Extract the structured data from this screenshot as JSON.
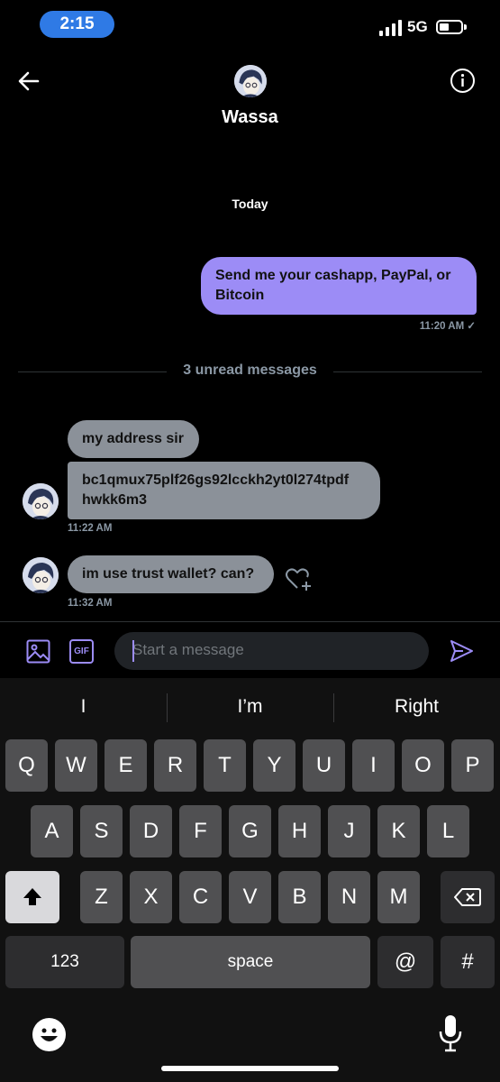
{
  "status_bar": {
    "time": "2:15",
    "network": "5G"
  },
  "header": {
    "name": "Wassa"
  },
  "thread": {
    "date": "Today",
    "outgoing": {
      "text": "Send me your cashapp, PayPal, or Bitcoin",
      "time": "11:20 AM ✓"
    },
    "unread_label": "3 unread messages",
    "incoming": [
      {
        "text": "my address sir"
      },
      {
        "text": "bc1qmux75plf26gs92lcckh2yt0l274tpdf hwkk6m3",
        "time": "11:22 AM"
      },
      {
        "text": "im use trust wallet? can?",
        "time": "11:32 AM"
      }
    ]
  },
  "composer": {
    "gif_label": "GIF",
    "placeholder": "Start a message"
  },
  "keyboard": {
    "suggestions": [
      "I",
      "I’m",
      "Right"
    ],
    "row1": [
      "Q",
      "W",
      "E",
      "R",
      "T",
      "Y",
      "U",
      "I",
      "O",
      "P"
    ],
    "row2": [
      "A",
      "S",
      "D",
      "F",
      "G",
      "H",
      "J",
      "K",
      "L"
    ],
    "row3": [
      "Z",
      "X",
      "C",
      "V",
      "B",
      "N",
      "M"
    ],
    "numbers_label": "123",
    "space_label": "space",
    "at_label": "@",
    "hash_label": "#"
  },
  "colors": {
    "accent": "#9c8cf6",
    "incoming_bubble": "#8b9199",
    "time_pill": "#2f7ae5"
  }
}
